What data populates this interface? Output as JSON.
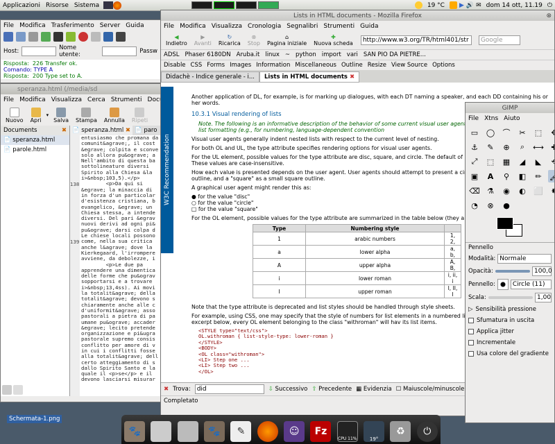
{
  "panel": {
    "menu": [
      "Applicazioni",
      "Risorse",
      "Sistema"
    ],
    "temp": "19 °C",
    "datetime": "dom 14 ott, 11.19"
  },
  "ftp": {
    "menu": [
      "File",
      "Modifica",
      "Trasferimento",
      "Server",
      "Guida"
    ],
    "host_label": "Host:",
    "user_label": "Nome utente:",
    "pass_label": "Passw",
    "log": [
      [
        "Risposta:",
        "226 Transfer ok."
      ],
      [
        "Comando:",
        "TYPE A"
      ],
      [
        "Risposta:",
        "200 Type set to A."
      ]
    ]
  },
  "gedit": {
    "title": "speranza.html (/media/sd",
    "menu": [
      "File",
      "Modifica",
      "Visualizza",
      "Cerca",
      "Strumenti",
      "Docume"
    ],
    "tools": [
      "Nuovo",
      "Apri",
      "Salva",
      "Stampa",
      "Annulla",
      "Ripeti"
    ],
    "side_title": "Documents",
    "files": [
      "speranza.html",
      "parole.html"
    ],
    "tabs": [
      "speranza.html",
      "paro"
    ],
    "line_numbers": [
      "138",
      "139"
    ],
    "code": "entusiasmo che promana da\ncomunit&agrave;, il cost\n&egrave; colpita e sconve\nsolo allora pu&ograve; a\nNell'ambito di questa ba\nsottolineature diversi\nSpirito alla Chiesa &la\ni>&nbsp;103,5).</p>\n        <p>Da qui si\n&egrave; la minaccia di\nin forza d'un particolar\nd'esistenza cristiana, b\nevangelico, &egrave; un\nChiesa stessa, a intende\ndiversi. Del pari &egrav\nnuovi derivi ad ogni pi&\npu&ograve; darsi colpa d\nLe chiese locali possono\ncome, nella sua critica\nanche l&agrave; dove la\nKierkegaard, l'irrompere\navviene, da debolezze, i\n        <p>Le due pa\napprendere una dimentica\ndelle forme che pu&ograv\nsopportarsi e a trovare\ni>&nbsp;13,4ss). Ai movi\nla totalit&agrave; della\ntotalit&agrave; devono s\nchiaramente anche alle c\nd'uniformit&agrave; asso\npastorali a pietra di pa\numane pu&ograve; accader\n&egrave; lecito pretende\norganizzazione e pi&ugra\npastorale supremo consis\nconflitto per amore di v\nin cui i conflitti fosse\nalla totalit&agrave; dell\ncerto atteggiamento di s\ndallo Spirito Santo e la\nquale il <p>se</p> e il\ndevono lasciarsi misurar"
  },
  "firefox": {
    "title": "Lists in HTML documents - Mozilla Firefox",
    "menu": [
      "File",
      "Modifica",
      "Visualizza",
      "Cronologia",
      "Segnalibri",
      "Strumenti",
      "Guida"
    ],
    "nav": [
      "Indietro",
      "Avanti",
      "Ricarica",
      "Stop",
      "Pagina iniziale",
      "Nuova scheda"
    ],
    "url": "http://www.w3.org/TR/html401/str",
    "search": "Google",
    "bookmarks": [
      "ADSL",
      "Phaser 6180DN",
      "Aruba.it",
      "linux",
      "~",
      "python",
      "import",
      "vari",
      "SAN PIO DA PIETRE..."
    ],
    "webdev": [
      "Disable",
      "CSS",
      "Forms",
      "Images",
      "Information",
      "Miscellaneous",
      "Outline",
      "Resize",
      "View Source",
      "Options"
    ],
    "tabs": [
      "Didachè - Indice generale - i...",
      "Lists in HTML documents"
    ],
    "w3c": "W3C Recommendation",
    "p1": "Another application of DL, for example, is for marking up dialogues, with each DT naming a speaker, and each DD containing his or her words.",
    "heading": "10.3.1 Visual rendering of lists",
    "note": "Note. The following is an informative description of the behavior of some current visual user agent sheets allow better control of list formatting (e.g., for numbering, language-dependent convention",
    "p2": "Visual user agents generally indent nested lists with respect to the current level of nesting.",
    "p3": "For both OL and UL, the type attribute specifies rendering options for visual user agents.",
    "p4": "For the UL element, possible values for the type attribute are disc, square, and circle. The default of nesting of the current list. These values are case-insensitive.",
    "p5": "How each value is presented depends on the user agent. User agents should attempt to present a circle, a \"circle\" as a small circle outline, and a \"square\" as a small square outline.",
    "p6": "A graphical user agent might render this as:",
    "bullets": [
      "for the value \"disc\"",
      "for the value \"circle\"",
      "for the value \"square\""
    ],
    "p7": "For the OL element, possible values for the type attribute are summarized in the table below (they a",
    "table_head": [
      "Type",
      "Numbering style"
    ],
    "table_rows": [
      [
        "1",
        "arabic numbers",
        "1, 2,"
      ],
      [
        "a",
        "lower alpha",
        "a, b,"
      ],
      [
        "A",
        "upper alpha",
        "A, B,"
      ],
      [
        "i",
        "lower roman",
        "i, ii, i"
      ],
      [
        "I",
        "upper roman",
        "I, II, I"
      ]
    ],
    "p8": "Note that the type attribute is deprecated and list styles should be handled through style sheets.",
    "p9": "For example, using CSS, one may specify that the style of numbers for list elements in a numbered li roman numerals. In the excerpt below, every OL element belonging to the class \"withroman\" will hav its list items.",
    "code": "<STYLE type=\"text/css\">\nOL.withroman { list-style-type: lower-roman }\n</STYLE>\n<BODY>\n<OL class=\"withroman\">\n<LI> Step one ...\n<LI> Step two ...\n</OL>",
    "find_label": "Trova:",
    "find_value": "did",
    "find_next": "Successivo",
    "find_prev": "Precedente",
    "find_hl": "Evidenzia",
    "find_case": "Maiuscole/minuscole",
    "status": "Completato"
  },
  "gimp": {
    "title": "GIMP",
    "menu": [
      "File",
      "Xtns",
      "Aiuto"
    ],
    "tool_icons": [
      "▭",
      "◯",
      "⌒",
      "✂",
      "⬚",
      "✥",
      "⚓",
      "✎",
      "⊕",
      "⌕",
      "⟷",
      "✚",
      "⤢",
      "⬚",
      "▦",
      "◢",
      "◣",
      "⟲",
      "▣",
      "A",
      "⚲",
      "◧",
      "✏",
      "🖌",
      "⌫",
      "⚗",
      "◉",
      "◐",
      "⬜",
      "✸",
      "◔",
      "⊗",
      "●"
    ],
    "panel_title": "Pennello",
    "mode_label": "Modalità:",
    "mode_value": "Normale",
    "opacity_label": "Opacità:",
    "opacity_value": "100,0",
    "brush_label": "Pennello:",
    "brush_value": "Circle (11)",
    "scale_label": "Scala:",
    "scale_value": "1,00",
    "pressure": "Sensibilità pressione",
    "options": [
      "Sfumatura in uscita",
      "Applica jitter",
      "Incrementale",
      "Usa colore del gradiente"
    ]
  },
  "desktop": {
    "icon_label": "Schermata-1.png",
    "dock_cpu": "CPU 11%",
    "dock_temp": "19°"
  }
}
